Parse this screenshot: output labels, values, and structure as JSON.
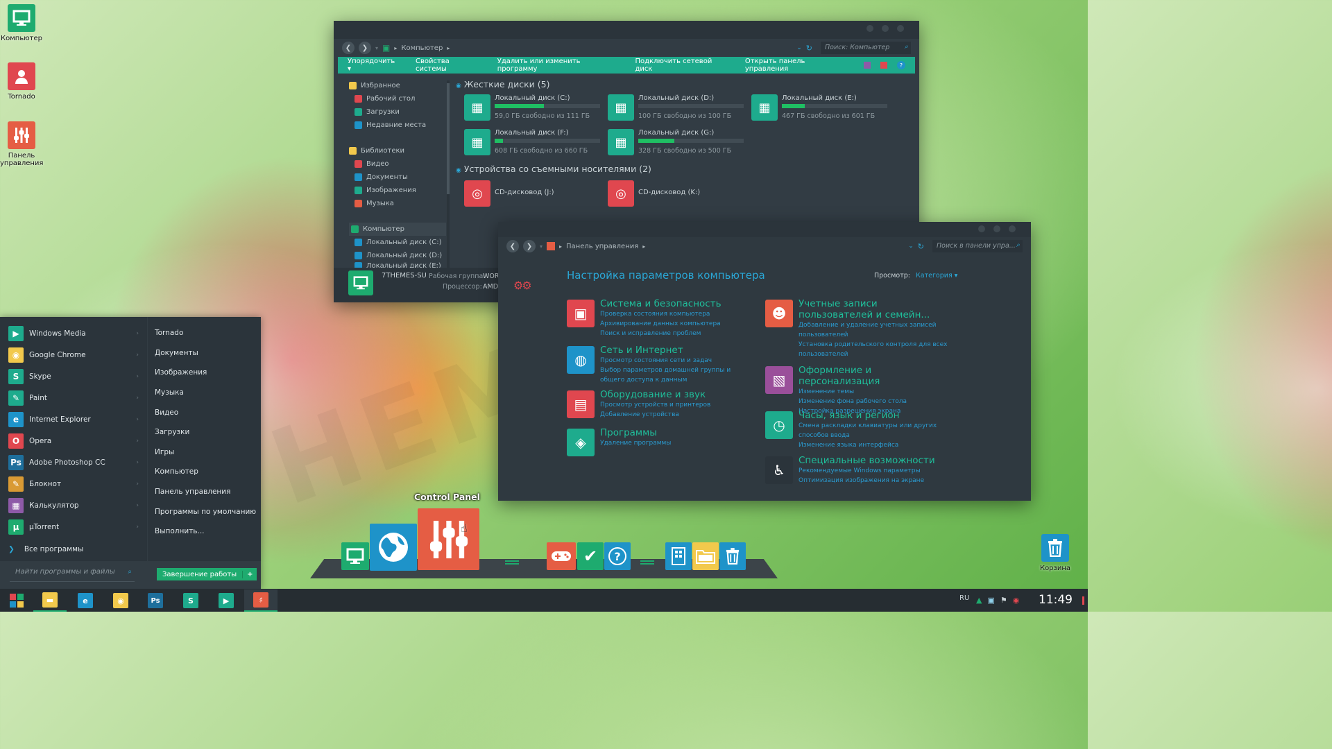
{
  "desktop": {
    "icons": [
      {
        "label": "Компьютер",
        "icon": "monitor-icon",
        "color": "#1eab6f"
      },
      {
        "label": "Tornado",
        "icon": "user-icon",
        "color": "#e0474f"
      },
      {
        "label": "Панель управления",
        "icon": "sliders-icon",
        "color": "#e55d44"
      }
    ],
    "recycle_label": "Корзина",
    "watermark": "7THEMES.SU"
  },
  "explorer": {
    "breadcrumb": "Компьютер",
    "search_placeholder": "Поиск: Компьютер",
    "commands": [
      "Упорядочить ▾",
      "Свойства системы",
      "Удалить или изменить программу",
      "Подключить сетевой диск",
      "Открыть панель управления"
    ],
    "nav": {
      "favorites": "Избранное",
      "desktop": "Рабочий стол",
      "downloads": "Загрузки",
      "recent": "Недавние места",
      "libraries": "Библиотеки",
      "video": "Видео",
      "documents": "Документы",
      "images": "Изображения",
      "music": "Музыка",
      "computer": "Компьютер",
      "disk_c": "Локальный диск (C:)",
      "disk_d": "Локальный диск (D:)",
      "disk_e": "Локальный диск (E:)"
    },
    "group_hdd": "Жесткие диски (5)",
    "group_removable": "Устройства со съемными носителями (2)",
    "drives": [
      {
        "name": "Локальный диск (C:)",
        "free": "59,0 ГБ свободно из 111 ГБ",
        "used": 0.47
      },
      {
        "name": "Локальный диск (D:)",
        "free": "100 ГБ свободно из 100 ГБ",
        "used": 0.0
      },
      {
        "name": "Локальный диск (E:)",
        "free": "467 ГБ свободно из 601 ГБ",
        "used": 0.22
      },
      {
        "name": "Локальный диск (F:)",
        "free": "608 ГБ свободно из 660 ГБ",
        "used": 0.08
      },
      {
        "name": "Локальный диск (G:)",
        "free": "328 ГБ свободно из 500 ГБ",
        "used": 0.34
      }
    ],
    "cd": [
      {
        "name": "CD-дисковод (J:)"
      },
      {
        "name": "CD-дисковод (K:)"
      }
    ],
    "details": {
      "name": "7THEMES-SU",
      "wg_label": "Рабочая группа:",
      "wg_value": "WOR",
      "cpu_label": "Процессор:",
      "cpu_value": "AMD"
    }
  },
  "control_panel": {
    "breadcrumb": "Панель управления",
    "search_placeholder": "Поиск в панели упра...",
    "title": "Настройка параметров компьютера",
    "view_label": "Просмотр:",
    "view_value": "Категория ▾",
    "left": [
      {
        "title": "Система и безопасность",
        "links": [
          "Проверка состояния компьютера",
          "Архивирование данных компьютера",
          "Поиск и исправление проблем"
        ],
        "color": "#e0474f",
        "icon": "shield-monitor-icon"
      },
      {
        "title": "Сеть и Интернет",
        "links": [
          "Просмотр состояния сети и задач",
          "Выбор параметров домашней группы и общего доступа к данным"
        ],
        "color": "#1e93c9",
        "icon": "globe-icon"
      },
      {
        "title": "Оборудование и звук",
        "links": [
          "Просмотр устройств и принтеров",
          "Добавление устройства"
        ],
        "color": "#e0474f",
        "icon": "printer-icon"
      },
      {
        "title": "Программы",
        "links": [
          "Удаление программы"
        ],
        "color": "#1eab8d",
        "icon": "programs-icon"
      }
    ],
    "right": [
      {
        "title": "Учетные записи пользователей и семейн...",
        "links": [
          "Добавление и удаление учетных записей пользователей",
          "Установка родительского контроля для всех пользователей"
        ],
        "color": "#e55d44",
        "icon": "users-icon"
      },
      {
        "title": "Оформление и персонализация",
        "links": [
          "Изменение темы",
          "Изменение фона рабочего стола",
          "Настройка разрешения экрана"
        ],
        "color": "#9a4f9a",
        "icon": "personalize-icon"
      },
      {
        "title": "Часы, язык и регион",
        "links": [
          "Смена раскладки клавиатуры или других способов ввода",
          "Изменение языка интерфейса"
        ],
        "color": "#1eab8d",
        "icon": "clock-region-icon"
      },
      {
        "title": "Специальные возможности",
        "links": [
          "Рекомендуемые Windows параметры",
          "Оптимизация изображения на экране"
        ],
        "color": "#2b343b",
        "icon": "accessibility-icon"
      }
    ]
  },
  "start_menu": {
    "programs": [
      {
        "label": "Windows Media",
        "icon": "media-player-icon",
        "color": "#1eab8d",
        "glyph": "▶"
      },
      {
        "label": "Google Chrome",
        "icon": "chrome-icon",
        "color": "#f2c94c",
        "glyph": "◉"
      },
      {
        "label": "Skype",
        "icon": "skype-icon",
        "color": "#1eab8d",
        "glyph": "S"
      },
      {
        "label": "Paint",
        "icon": "paint-icon",
        "color": "#1eab8d",
        "glyph": "✎"
      },
      {
        "label": "Internet Explorer",
        "icon": "ie-icon",
        "color": "#1e93c9",
        "glyph": "e"
      },
      {
        "label": "Opera",
        "icon": "opera-icon",
        "color": "#e0474f",
        "glyph": "O"
      },
      {
        "label": "Adobe Photoshop CC",
        "icon": "photoshop-icon",
        "color": "#1e6f9c",
        "glyph": "Ps"
      },
      {
        "label": "Блокнот",
        "icon": "notepad-icon",
        "color": "#d99a34",
        "glyph": "✎"
      },
      {
        "label": "Калькулятор",
        "icon": "calculator-icon",
        "color": "#8e5aa8",
        "glyph": "▦"
      },
      {
        "label": "µTorrent",
        "icon": "utorrent-icon",
        "color": "#1eab6f",
        "glyph": "µ"
      }
    ],
    "all_programs": "Все программы",
    "places": [
      "Tornado",
      "Документы",
      "Изображения",
      "Музыка",
      "Видео",
      "Загрузки",
      "Игры",
      "Компьютер",
      "Панель управления",
      "Программы по умолчанию",
      "Выполнить..."
    ],
    "search_placeholder": "Найти программы и файлы",
    "shutdown": "Завершение работы"
  },
  "dock": {
    "tooltip": "Control Panel"
  },
  "taskbar": {
    "lang": "RU",
    "time": "11:49"
  }
}
